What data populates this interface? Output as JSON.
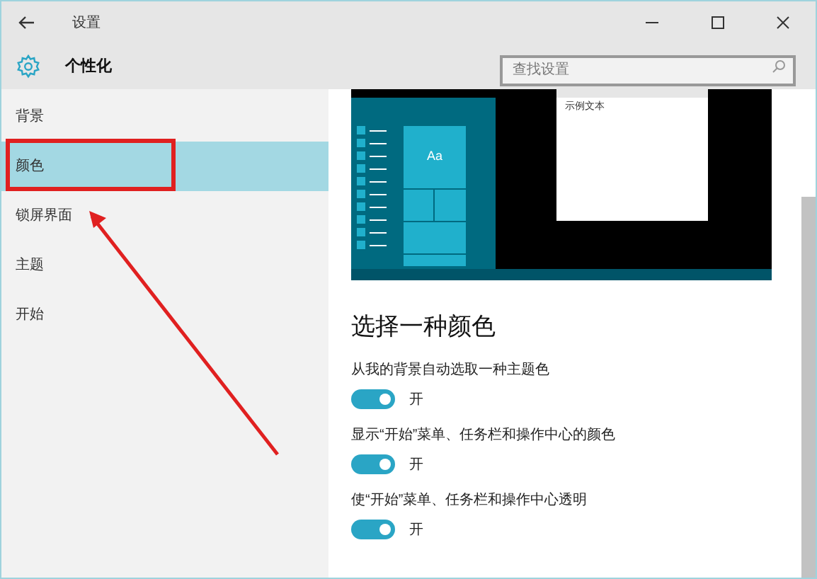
{
  "window": {
    "title": "设置"
  },
  "header": {
    "title": "个性化",
    "search": {
      "placeholder": "查找设置"
    }
  },
  "sidebar": {
    "items": [
      {
        "label": "背景",
        "selected": false
      },
      {
        "label": "颜色",
        "selected": true
      },
      {
        "label": "锁屏界面",
        "selected": false
      },
      {
        "label": "主题",
        "selected": false
      },
      {
        "label": "开始",
        "selected": false
      }
    ]
  },
  "preview": {
    "tile_text": "Aa",
    "sample_text": "示例文本"
  },
  "section": {
    "title": "选择一种颜色",
    "settings": [
      {
        "label": "从我的背景自动选取一种主题色",
        "on": true,
        "state_text": "开"
      },
      {
        "label": "显示“开始”菜单、任务栏和操作中心的颜色",
        "on": true,
        "state_text": "开"
      },
      {
        "label": "使“开始”菜单、任务栏和操作中心透明",
        "on": true,
        "state_text": "开"
      }
    ]
  }
}
